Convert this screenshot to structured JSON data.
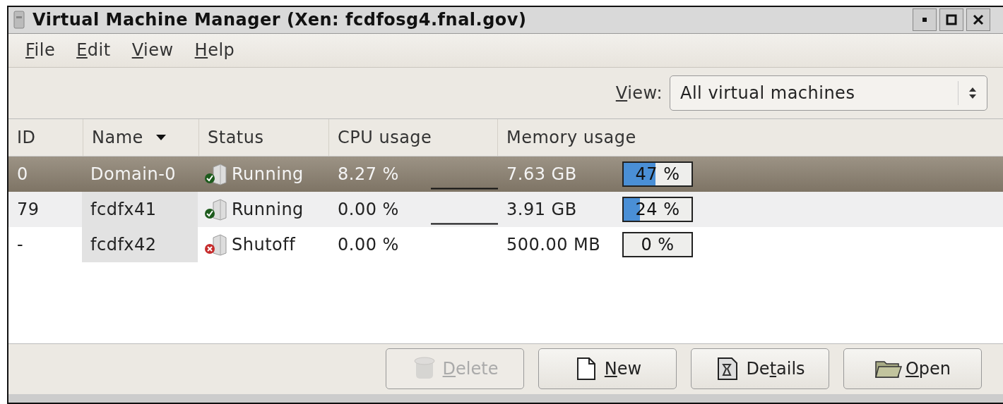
{
  "window": {
    "title": "Virtual Machine Manager (Xen: fcdfosg4.fnal.gov)"
  },
  "menu": [
    {
      "access_key": "F",
      "rest": "ile"
    },
    {
      "access_key": "E",
      "rest": "dit"
    },
    {
      "access_key": "V",
      "rest": "iew"
    },
    {
      "access_key": "H",
      "rest": "elp"
    }
  ],
  "view_filter": {
    "access_key": "V",
    "rest": "iew:",
    "value": "All virtual machines"
  },
  "table": {
    "columns": [
      {
        "label": "ID",
        "sorted": false
      },
      {
        "label": "Name",
        "sorted": true
      },
      {
        "label": "Status",
        "sorted": false
      },
      {
        "label": "CPU usage",
        "sorted": false
      },
      {
        "label": "Memory usage",
        "sorted": false
      }
    ],
    "rows": [
      {
        "id": "0",
        "name": "Domain-0",
        "status": "Running",
        "kind": "running",
        "cpu": "8.27 %",
        "cpu_graph": true,
        "memory": "7.63 GB",
        "level": 0.47,
        "percent": "47 %",
        "selected": true
      },
      {
        "id": "79",
        "name": "fcdfx41",
        "status": "Running",
        "kind": "running",
        "cpu": "0.00 %",
        "cpu_graph": true,
        "memory": "3.91 GB",
        "level": 0.24,
        "percent": "24 %",
        "selected": false
      },
      {
        "id": "-",
        "name": "fcdfx42",
        "status": "Shutoff",
        "kind": "shutoff",
        "cpu": "0.00 %",
        "cpu_graph": false,
        "memory": "500.00 MB",
        "level": 0,
        "percent": "0 %",
        "selected": false
      }
    ]
  },
  "buttons": [
    {
      "access_key": "D",
      "rest": "elete",
      "kind": "delete",
      "disabled": true
    },
    {
      "access_key": "N",
      "rest": "ew",
      "kind": "new",
      "disabled": false
    },
    {
      "before": "De",
      "access_key": "t",
      "rest": "ails",
      "kind": "details",
      "disabled": false
    },
    {
      "access_key": "O",
      "rest": "pen",
      "kind": "open",
      "disabled": false
    }
  ]
}
